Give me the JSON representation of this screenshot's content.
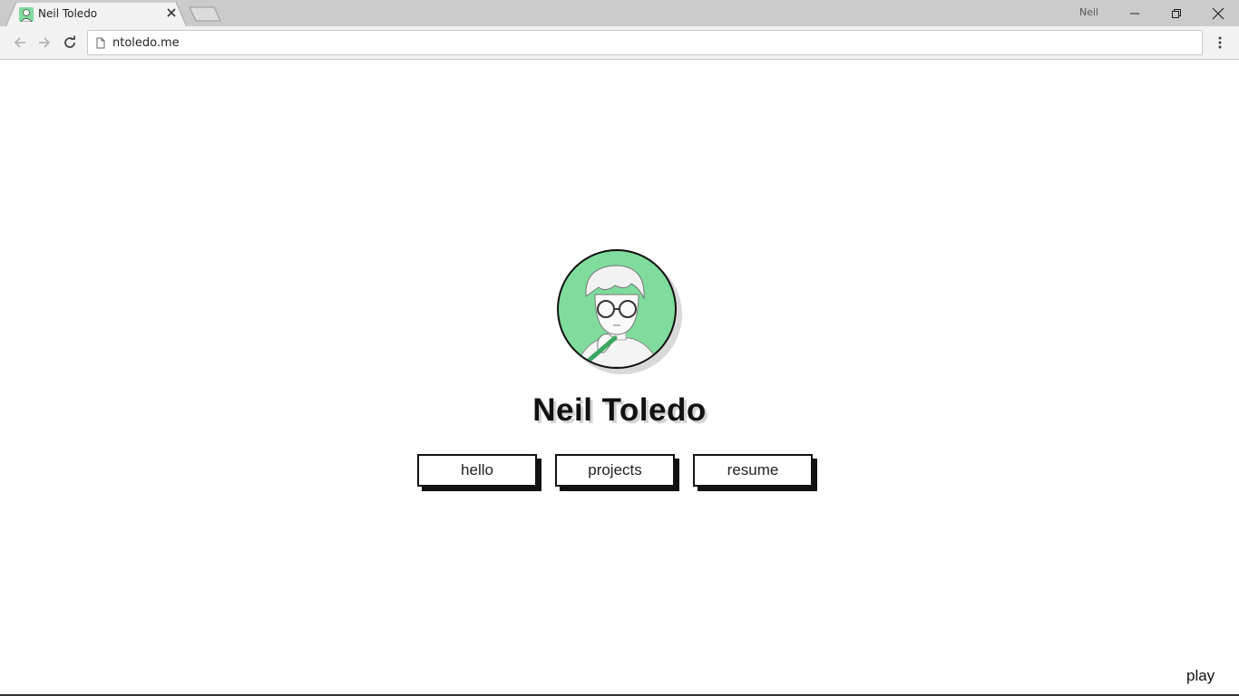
{
  "browser": {
    "tab": {
      "title": "Neil Toledo"
    },
    "profile_name": "Neil",
    "address": {
      "url": "ntoledo.me"
    },
    "accent_color": "#7fdc9c"
  },
  "page": {
    "avatar": {
      "icon": "illustrated-portrait",
      "background_color": "#7fdc9c"
    },
    "name": "Neil Toledo",
    "buttons": [
      {
        "label": "hello"
      },
      {
        "label": "projects"
      },
      {
        "label": "resume"
      }
    ],
    "play_label": "play"
  }
}
